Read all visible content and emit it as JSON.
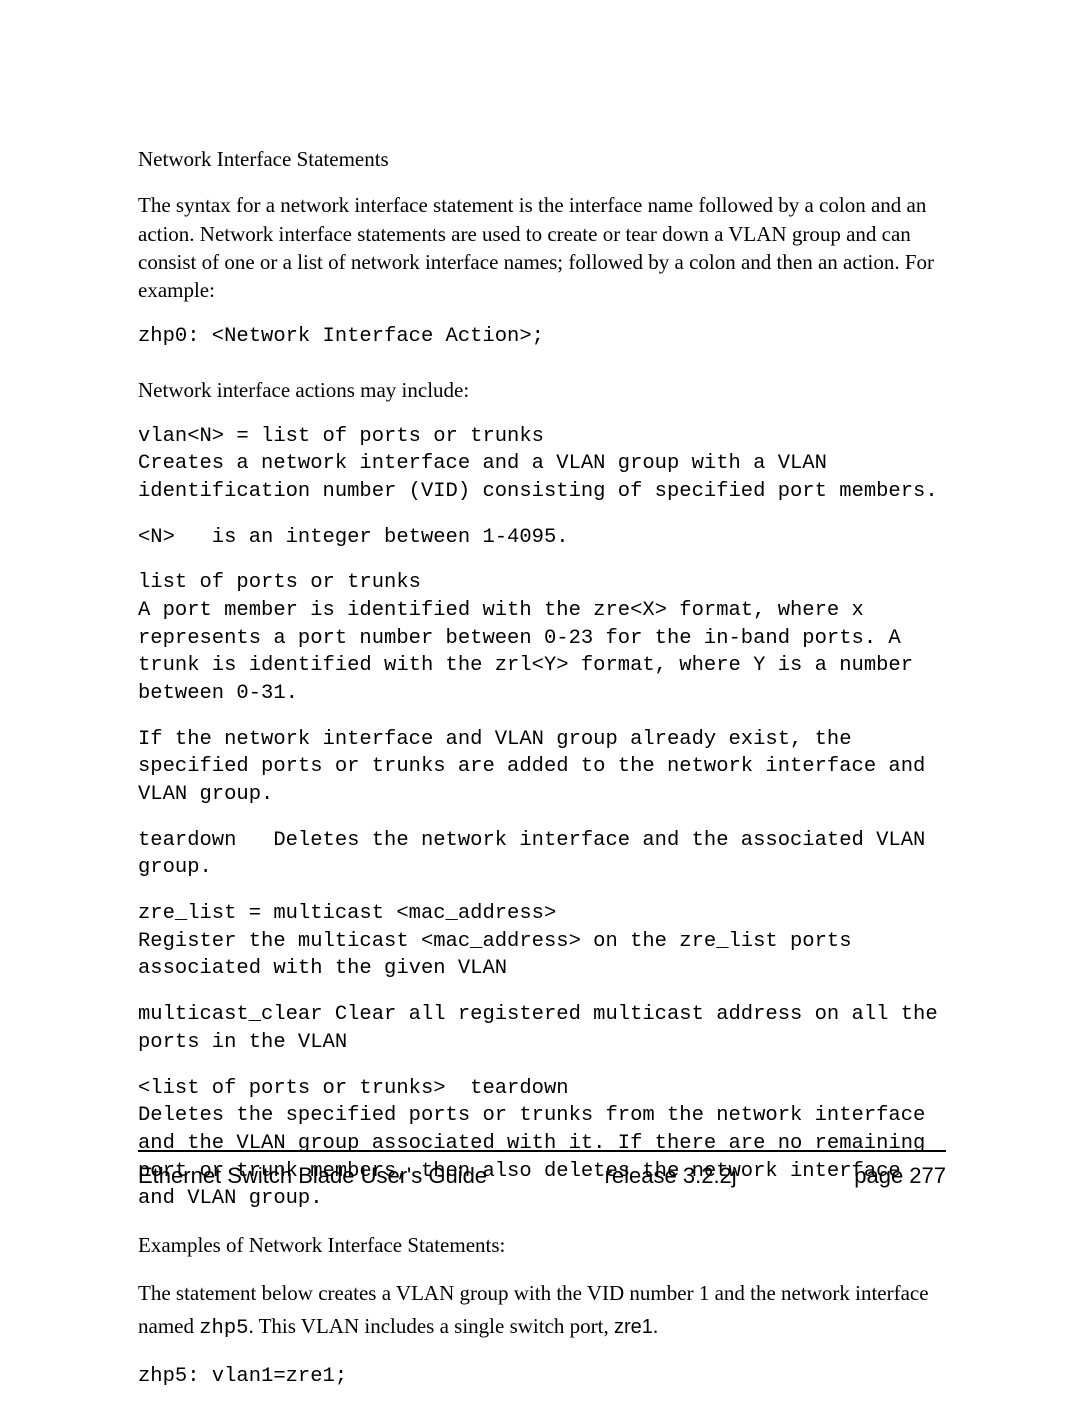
{
  "headings": {
    "nis": "Network Interface Statements"
  },
  "paras": {
    "intro": "The syntax for a network interface statement is the interface name followed by a colon and an action. Network interface statements are used to create or tear down a VLAN group and can consist of one or a list of network interface names; followed by a colon and then an action.  For example:",
    "actions_may_include": "Network interface actions may include:",
    "examples_heading": "Examples of Network Interface Statements:"
  },
  "mono": {
    "zhp0": "zhp0: <Network Interface Action>;",
    "vlan_block": "vlan<N> = list of ports or trunks\nCreates a network interface and a VLAN group with a VLAN identification number (VID) consisting of specified port members.",
    "n_is": "<N>   is an integer between 1-4095.",
    "list_ports": "list of ports or trunks\nA port member is identified with the zre<X> format, where x represents a port number between 0-23 for the in-band ports. A trunk is identified with the zrl<Y> format, where Y is a number between 0-31.",
    "if_exist": "If the network interface and VLAN group already exist, the specified ports or trunks are added to the network interface and VLAN group.",
    "teardown": "teardown   Deletes the network interface and the associated VLAN group.",
    "zre_list": "zre_list = multicast <mac_address>\nRegister the multicast <mac_address> on the zre_list ports associated with the given VLAN",
    "multicast_clear": "multicast_clear Clear all registered multicast address on all the ports in the VLAN",
    "list_teardown": "<list of ports or trunks>  teardown\nDeletes the specified ports or trunks from the network interface and the VLAN group associated with it. If there are no remaining port or trunk members, then also deletes the network interface and VLAN group.",
    "zhp5_stmt": "zhp5: vlan1=zre1;"
  },
  "mixed": {
    "example_pre": "The statement below creates a VLAN group with the VID number 1 and the network interface named ",
    "example_zhp5": "zhp5",
    "example_mid": ". This VLAN includes a single switch port, ",
    "example_zre1": "zre1",
    "example_post": "."
  },
  "footer": {
    "left": "Ethernet Switch Blade User's Guide",
    "mid": "release  3.2.2j",
    "right": "page  277"
  }
}
